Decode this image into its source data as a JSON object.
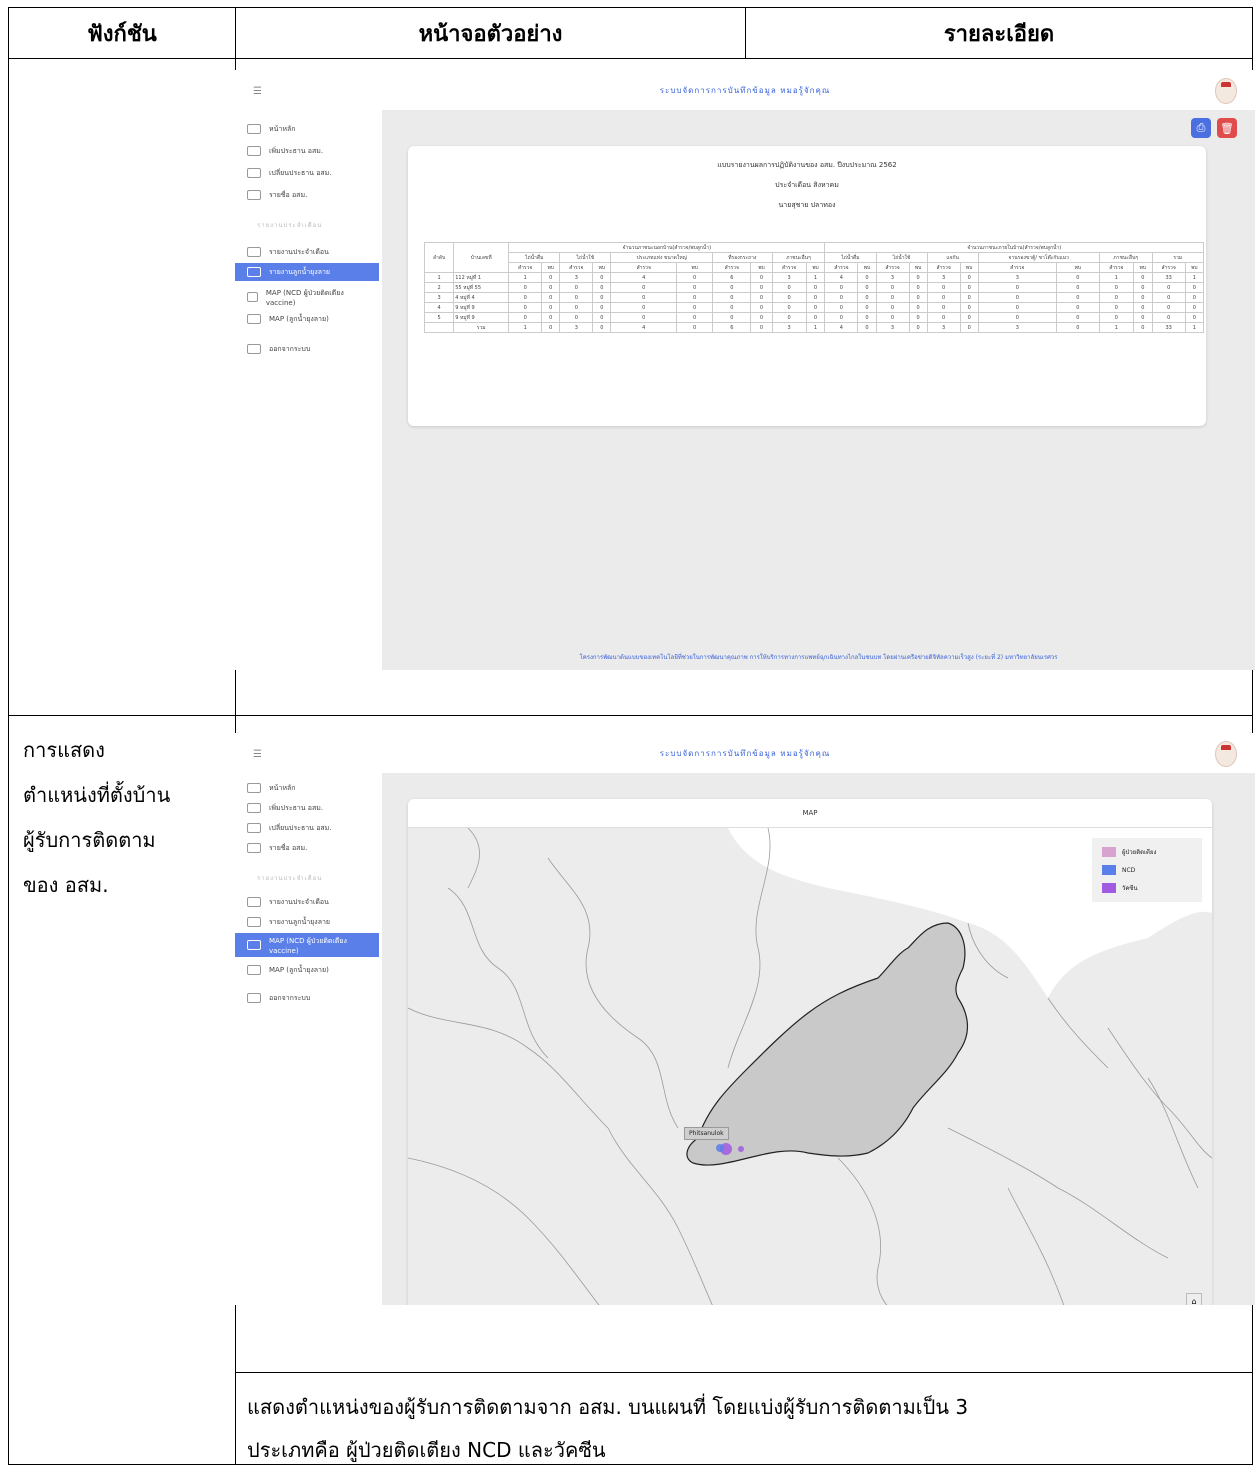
{
  "table": {
    "headers": {
      "function": "ฟังก์ชัน",
      "screen": "หน้าจอตัวอย่าง",
      "details": "รายละเอียด"
    },
    "row2": {
      "function_lines": [
        "การแสดง",
        "ตำแหน่งที่ตั้งบ้าน",
        "ผู้รับการติดตาม",
        "ของ  อสม."
      ],
      "description_lines": [
        "แสดงตำแหน่งของผู้รับการติดตามจาก อสม. บนแผนที่ โดยแบ่งผู้รับการติดตามเป็น 3",
        "ประเภทคือ ผู้ป่วยติดเตียง NCD และวัคซีน"
      ]
    }
  },
  "app": {
    "title": "ระบบจัดการการบันทึกข้อมูล หมอรู้จักคุณ",
    "sidebar": {
      "items": [
        {
          "label": "หน้าหลัก",
          "icon": "home-icon"
        },
        {
          "label": "เพิ่มประธาน อสม.",
          "icon": "add-user-icon"
        },
        {
          "label": "เปลี่ยนประธาน อสม.",
          "icon": "swap-icon"
        },
        {
          "label": "รายชื่อ อสม.",
          "icon": "users-icon"
        }
      ],
      "section": "รายงานประจำเดือน",
      "report_items": [
        {
          "label": "รายงานประจำเดือน",
          "icon": "clipboard-check-icon"
        },
        {
          "label": "รายงานลูกน้ำยุงลาย",
          "icon": "clipboard-icon"
        },
        {
          "label": "MAP (NCD ผู้ป่วยติดเตียง vaccine)",
          "icon": "map-icon"
        },
        {
          "label": "MAP (ลูกน้ำยุงลาย)",
          "icon": "map-icon"
        }
      ],
      "logout": {
        "label": "ออกจากระบบ",
        "icon": "logout-icon"
      }
    },
    "report": {
      "title": "แบบรายงานผลการปฏิบัติงานของ อสม. ปีงบประมาณ 2562",
      "month": "ประจำเดือน สิงหาคม",
      "name": "นายสุชาย ปลาทอง",
      "group_header_1": "จำนวนภาชนะนอกบ้าน(สำรวจ/พบลูกน้ำ)",
      "group_header_2": "จำนวนภาชนะภายในบ้าน(สำรวจ/พบลูกน้ำ)",
      "col_no": "ลำดับ",
      "col_house": "บ้านเลขที่",
      "sub_headers": [
        "ไถ่น้ำดื่ม",
        "ไถ่น้ำใช้",
        "ประเภทแห่ง ขนาดใหญ่",
        "ที่รองกระถาง",
        "ภาชนะอื่นๆ",
        "ไถ่น้ำดื่ม",
        "ไถ่น้ำใช้",
        "แจกัน",
        "จานรองขาตู้/ ขาโต๊ะกับแมว",
        "ภาชนะอื่นๆ",
        "รวม"
      ],
      "sub_sub": [
        "สำรวจ",
        "พบ"
      ],
      "rows": [
        {
          "no": "1",
          "house": "112 หมู่ที่ 1",
          "v": [
            "1",
            "0",
            "3",
            "0",
            "4",
            "0",
            "6",
            "0",
            "3",
            "1",
            "4",
            "0",
            "3",
            "0",
            "3",
            "0",
            "3",
            "0",
            "1",
            "0",
            "33",
            "1"
          ]
        },
        {
          "no": "2",
          "house": "55 หมู่ที่ 55",
          "v": [
            "0",
            "0",
            "0",
            "0",
            "0",
            "0",
            "0",
            "0",
            "0",
            "0",
            "0",
            "0",
            "0",
            "0",
            "0",
            "0",
            "0",
            "0",
            "0",
            "0",
            "0",
            "0"
          ]
        },
        {
          "no": "3",
          "house": "4 หมู่ที่ 4",
          "v": [
            "0",
            "0",
            "0",
            "0",
            "0",
            "0",
            "0",
            "0",
            "0",
            "0",
            "0",
            "0",
            "0",
            "0",
            "0",
            "0",
            "0",
            "0",
            "0",
            "0",
            "0",
            "0"
          ]
        },
        {
          "no": "4",
          "house": "9 หมู่ที่ 9",
          "v": [
            "0",
            "0",
            "0",
            "0",
            "0",
            "0",
            "0",
            "0",
            "0",
            "0",
            "0",
            "0",
            "0",
            "0",
            "0",
            "0",
            "0",
            "0",
            "0",
            "0",
            "0",
            "0"
          ]
        },
        {
          "no": "5",
          "house": "9 หมู่ที่ 9",
          "v": [
            "0",
            "0",
            "0",
            "0",
            "0",
            "0",
            "0",
            "0",
            "0",
            "0",
            "0",
            "0",
            "0",
            "0",
            "0",
            "0",
            "0",
            "0",
            "0",
            "0",
            "0",
            "0"
          ]
        }
      ],
      "total_label": "รวม",
      "total": [
        "1",
        "0",
        "3",
        "0",
        "4",
        "0",
        "6",
        "0",
        "3",
        "1",
        "4",
        "0",
        "3",
        "0",
        "3",
        "0",
        "3",
        "0",
        "1",
        "0",
        "33",
        "1"
      ]
    },
    "footer": "โครงการพัฒนาต้นแบบของเทคโนโลยีที่ช่วยในการพัฒนาคุณภาพ การให้บริการทางการแพทย์ฉุกเฉินทางไกลในชนบท โดยผ่านเครือข่ายดิจิทัลความเร็วสูง (ระยะที่ 2) มหาวิทยาลัยนเรศวร",
    "map": {
      "title": "MAP",
      "legend": [
        {
          "label": "ผู้ป่วยติดเตียง",
          "color": "#d9a3cf"
        },
        {
          "label": "NCD",
          "color": "#5b7fe8"
        },
        {
          "label": "วัคซีน",
          "color": "#a05be0"
        }
      ],
      "tooltip": "Phitsanulok"
    }
  }
}
